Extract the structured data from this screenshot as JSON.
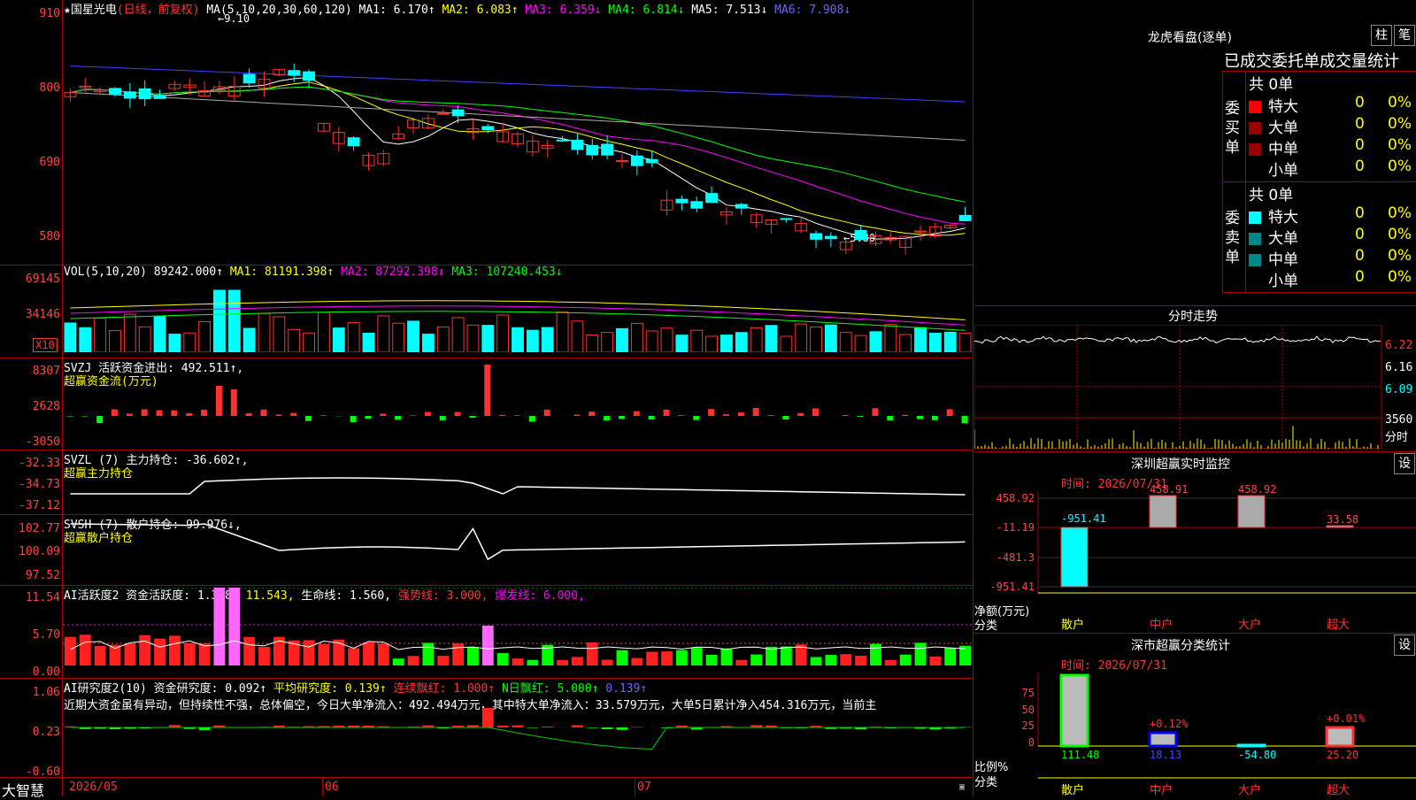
{
  "stock": {
    "star": "★",
    "name": "国星光电",
    "period": "(日线，前复权)"
  },
  "ma": {
    "label": "MA(5,10,20,30,60,120)",
    "v1": "MA1: 6.170↑",
    "v2": "MA2: 6.083↑",
    "v3": "MA3: 6.359↓",
    "v4": "MA4: 6.814↓",
    "v5": "MA5: 7.513↓",
    "v6": "MA6: 7.908↓"
  },
  "price_axis": [
    "910",
    "800",
    "690",
    "580"
  ],
  "price_marks": {
    "high": "←9.10",
    "low": "←5.80"
  },
  "vol": {
    "label": "VOL(5,10,20)",
    "value": "89242.000↑",
    "ma1": "MA1: 81191.398↑",
    "ma2": "MA2: 87292.398↓",
    "ma3": "MA3: 107240.453↓",
    "axis": [
      "69145",
      "34146"
    ],
    "unit": "X10"
  },
  "svzj": {
    "label": "SVZJ  活跃资金进出: 492.511↑,",
    "sub": "超赢资金流(万元)",
    "axis": [
      "8307",
      "2628",
      "-3050"
    ]
  },
  "svzl": {
    "label": "SVZL (7) 主力持仓: -36.602↑,",
    "sub": "超赢主力持仓",
    "axis": [
      "-32.33",
      "-34.73",
      "-37.12"
    ]
  },
  "svsh": {
    "label": "SVSH (7) 散户持仓: 99.976↓,",
    "sub": "超赢散户持仓",
    "axis": [
      "102.77",
      "100.09",
      "97.52"
    ]
  },
  "ai1": {
    "label": "AI活跃度2 资金活跃度: 1.368↑",
    "v2": "11.543,",
    "v3": "生命线: 1.560,",
    "v4": "强势线: 3.000,",
    "v5": "爆发线: 6.000,",
    "axis": [
      "11.54",
      "5.70",
      "0.00"
    ]
  },
  "ai2": {
    "label": "AI研究度2(10) 资金研究度: 0.092↑",
    "v2": "平均研究度: 0.139↑",
    "v3": "连续飘红: 1.000↑",
    "v4": "N日飘红: 5.000↑",
    "v5": "0.139↑",
    "text": "近期大资金虽有异动，但持续性不强，总体偏空，今日大单净流入：492.494万元，其中特大单净流入：33.579万元，大单5日累计净入454.316万元，当前主",
    "axis": [
      "1.06",
      "0.23",
      "-0.60"
    ]
  },
  "date_axis": [
    "2026/05",
    "06",
    "07"
  ],
  "brand": "大智慧",
  "right": {
    "lhb_title": "龙虎看盘(逐单)",
    "btn1": "柱",
    "btn2": "笔",
    "tabs_text": "已成交委托单成交量统计",
    "buy_side": "委买单",
    "sell_side": "委卖单",
    "buy_total": "共 0单",
    "sell_total": "共 0单",
    "rows": [
      {
        "label": "特大",
        "n": "0",
        "p": "0%"
      },
      {
        "label": "大单",
        "n": "0",
        "p": "0%"
      },
      {
        "label": "中单",
        "n": "0",
        "p": "0%"
      },
      {
        "label": "小单",
        "n": "0",
        "p": "0%"
      }
    ],
    "minute_title": "分时走势",
    "minute_axis": [
      "6.22",
      "6.16",
      "6.09"
    ],
    "minute_vol": "3560",
    "minute_unit": "分时",
    "sz_title": "深圳超赢实时监控",
    "sz_btn": "设",
    "sz_time": "时间: 2026/07/31",
    "sz_axis": [
      "458.92",
      "-11.19",
      "-481.3",
      "-951.41"
    ],
    "sz_vals": [
      "-951.41",
      "458.91",
      "458.92",
      "33.58"
    ],
    "sz_ylabel": "净额(万元)",
    "sz_xlabel": "分类",
    "cats": [
      "散户",
      "中户",
      "大户",
      "超大"
    ],
    "fl_title": "深市超赢分类统计",
    "fl_btn": "设",
    "fl_time": "时间: 2026/07/31",
    "fl_axis": [
      "75",
      "50",
      "25",
      "0"
    ],
    "fl_pcts": [
      "+0.12%",
      "+0.01%"
    ],
    "fl_vals": [
      "111.48",
      "18.13",
      "-54.80",
      "25.20"
    ],
    "fl_ylabel": "比例%",
    "fl_xlabel": "分类"
  },
  "colors": {
    "up": "#ff3030",
    "down": "#00ffff",
    "grid": "#aa0000",
    "ma1": "#ffffff",
    "ma2": "#ffff00",
    "ma3": "#ff00ff",
    "ma4": "#00ff00",
    "ma5": "#aaaaaa",
    "ma6": "#4040ff"
  }
}
